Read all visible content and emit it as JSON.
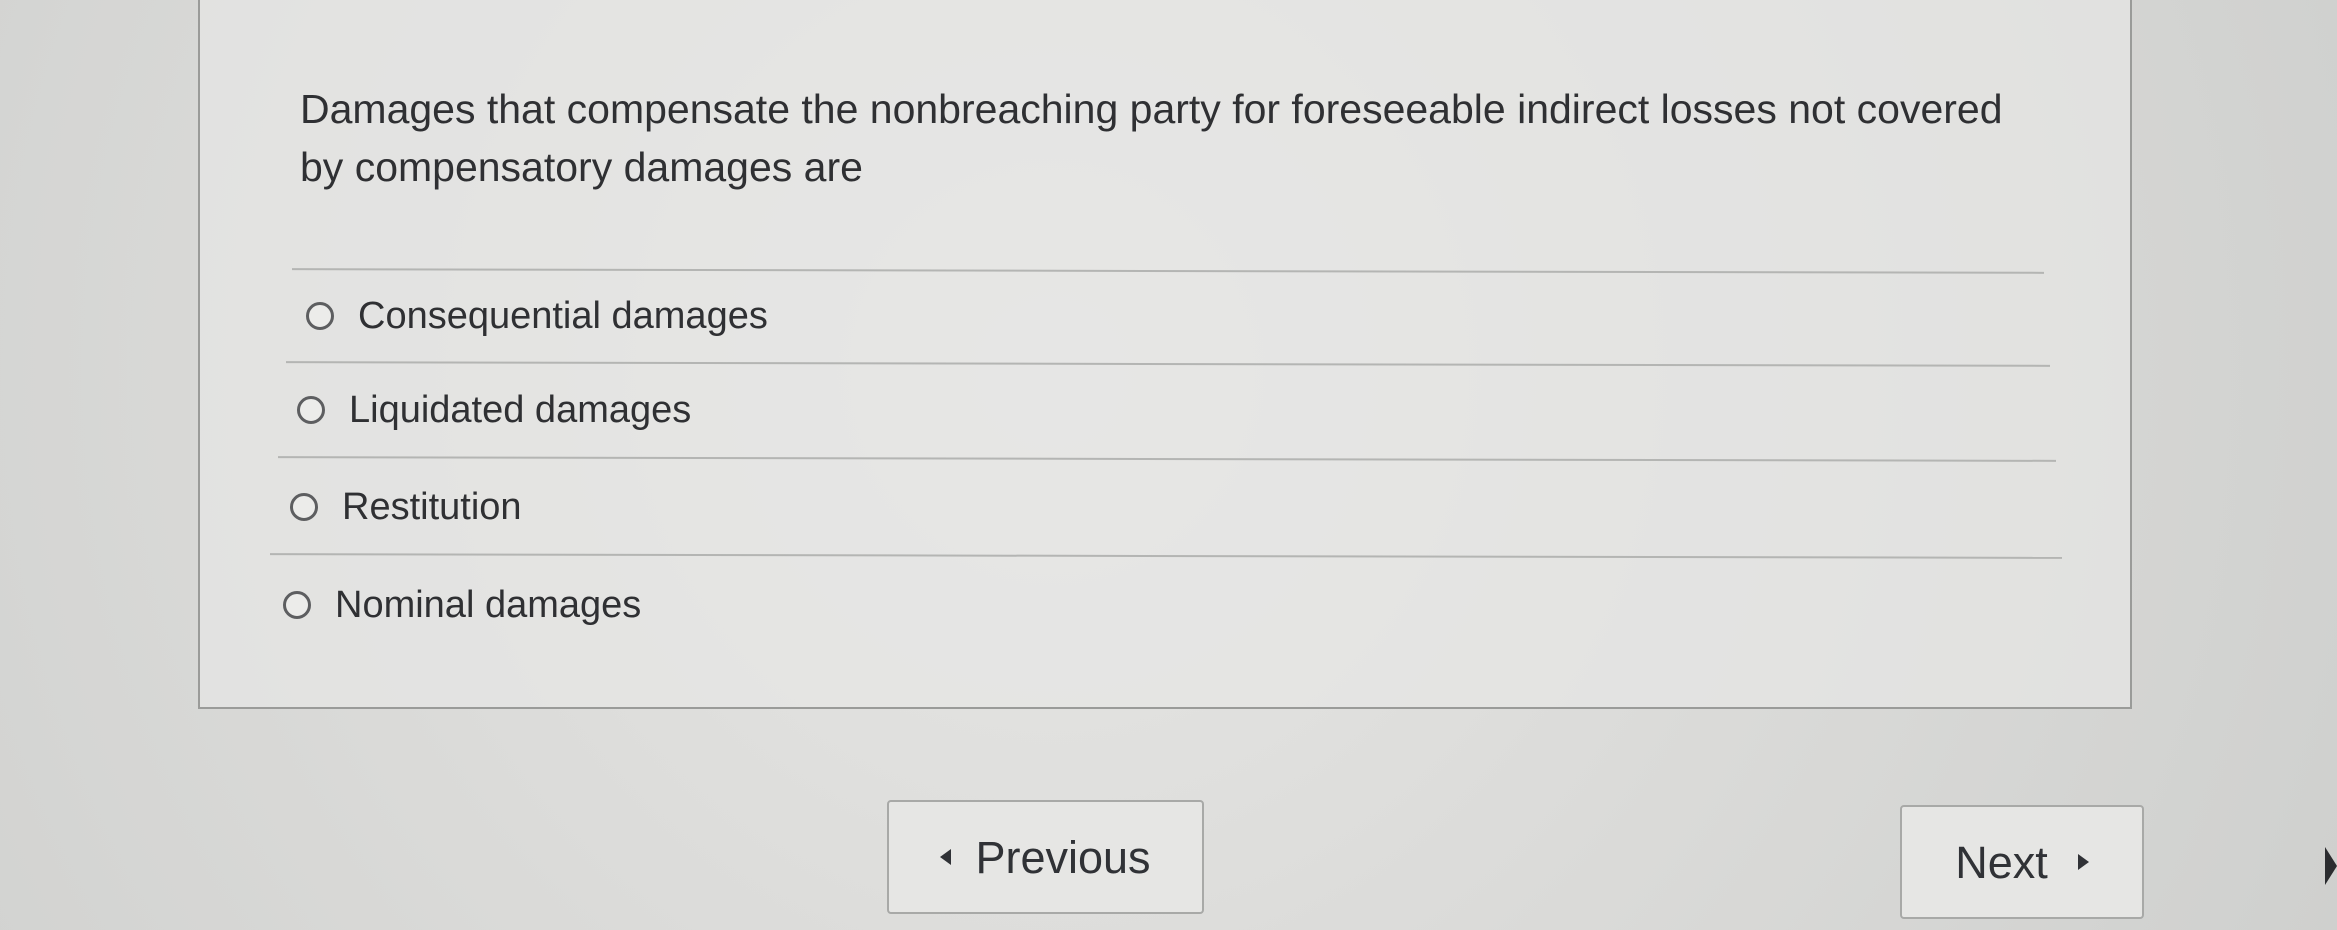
{
  "question": {
    "text": "Damages that compensate the nonbreaching party for foreseeable indirect losses not covered by compensatory damages are"
  },
  "options": [
    {
      "label": "Consequential damages",
      "selected": false
    },
    {
      "label": "Liquidated damages",
      "selected": false
    },
    {
      "label": "Restitution",
      "selected": false
    },
    {
      "label": "Nominal damages",
      "selected": false
    }
  ],
  "navigation": {
    "previous_label": "Previous",
    "next_label": "Next"
  }
}
